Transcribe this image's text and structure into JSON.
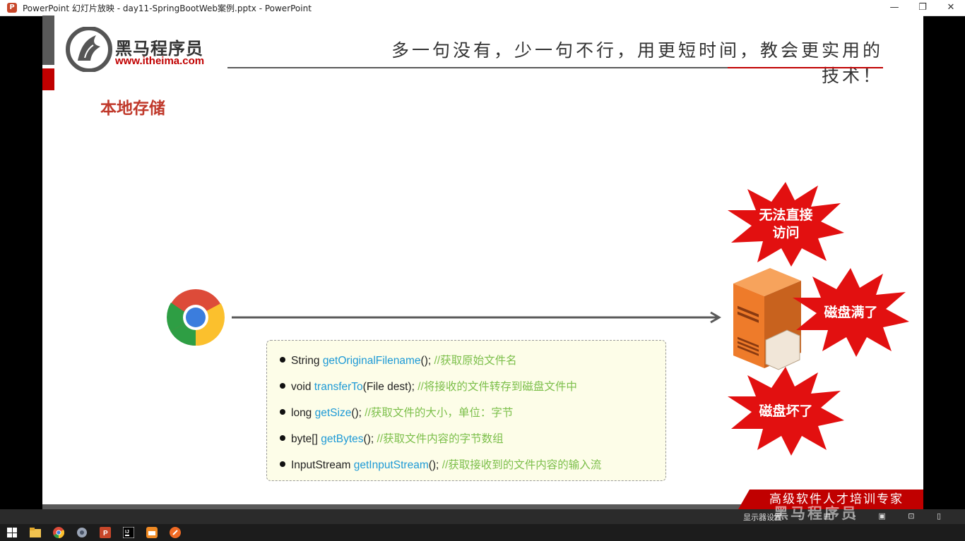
{
  "window": {
    "title": "PowerPoint 幻灯片放映  -  day11-SpringBootWeb案例.pptx - PowerPoint",
    "app_icon_letter": "P",
    "controls": {
      "minimize": "—",
      "restore": "❐",
      "close": "✕"
    }
  },
  "slide": {
    "logo": {
      "name": "黑马程序员",
      "url": "www.itheima.com"
    },
    "motto": "多一句没有，少一句不行，用更短时间，教会更实用的技术！",
    "title": "本地存储",
    "methods": [
      {
        "type": "String",
        "fn": "getOriginalFilename",
        "suffix": "();",
        "comment": "//获取原始文件名"
      },
      {
        "type": "void",
        "fn": "transferTo",
        "suffix": "(File dest);",
        "comment": "//将接收的文件转存到磁盘文件中"
      },
      {
        "type": "long",
        "fn": "getSize",
        "suffix": "();",
        "comment": "//获取文件的大小，单位：字节"
      },
      {
        "type": "byte[]",
        "fn": "getBytes",
        "suffix": "();",
        "comment": "//获取文件内容的字节数组"
      },
      {
        "type": "InputStream",
        "fn": "getInputStream",
        "suffix": "();",
        "comment": "//获取接收到的文件内容的输入流"
      }
    ],
    "bursts": {
      "access": {
        "line1": "无法直接",
        "line2": "访问"
      },
      "full": "磁盘满了",
      "broken": "磁盘坏了"
    },
    "footer_banner": "高级软件人才培训专家"
  },
  "statusbar": {
    "display_settings": "显示器设置",
    "nav_icons": "‹ ▤ › ▣ ⊡ ▯"
  },
  "watermark": "黑马程序员",
  "colors": {
    "brand_red": "#c00000",
    "fn_blue": "#1e9ad6",
    "comment_green": "#7cbf4a",
    "burst_red": "#e21010"
  }
}
